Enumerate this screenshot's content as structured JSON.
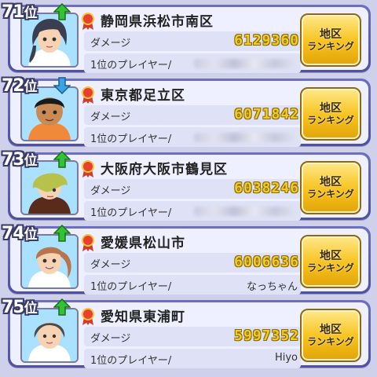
{
  "rows": [
    {
      "rank_num": "71",
      "rank_unit": "位",
      "trend": "up",
      "region": "静岡県浜松市南区",
      "damage_label": "ダメージ",
      "damage": "6129360",
      "player_label": "1位のプレイヤー/",
      "player_name": "",
      "player_blurred": true,
      "button_line1": "地区",
      "button_line2": "ランキング",
      "avatar": "girl-long-hair"
    },
    {
      "rank_num": "72",
      "rank_unit": "位",
      "trend": "down",
      "region": "東京都足立区",
      "damage_label": "ダメージ",
      "damage": "6071842",
      "player_label": "1位のプレイヤー/",
      "player_name": "",
      "player_blurred": true,
      "button_line1": "地区",
      "button_line2": "ランキング",
      "avatar": "boy-short-black-hair"
    },
    {
      "rank_num": "73",
      "rank_unit": "位",
      "trend": "up",
      "region": "大阪府大阪市鶴見区",
      "damage_label": "ダメージ",
      "damage": "6038246",
      "player_label": "1位のプレイヤー/",
      "player_name": "",
      "player_blurred": true,
      "button_line1": "地区",
      "button_line2": "ランキング",
      "avatar": "green-hair-shy"
    },
    {
      "rank_num": "74",
      "rank_unit": "位",
      "trend": "up",
      "region": "愛媛県松山市",
      "damage_label": "ダメージ",
      "damage": "6006636",
      "player_label": "1位のプレイヤー/",
      "player_name": "なっちゃん",
      "player_blurred": false,
      "button_line1": "地区",
      "button_line2": "ランキング",
      "avatar": "girl-ponytail"
    },
    {
      "rank_num": "75",
      "rank_unit": "位",
      "trend": "up",
      "region": "愛知県東浦町",
      "damage_label": "ダメージ",
      "damage": "5997352",
      "player_label": "1位のプレイヤー/",
      "player_name": "Hiyo",
      "player_blurred": false,
      "button_line1": "地区",
      "button_line2": "ランキング",
      "avatar": "woman-dark-hair"
    }
  ],
  "colors": {
    "background": "#cfd1ea",
    "row_frame": "#5a5ab0",
    "row_fill": "#eef0ff",
    "damage_gold": "#f2cb25",
    "trend_up": "#33c233",
    "trend_down": "#3aa3e6",
    "button_gold": "#f6c21a"
  }
}
